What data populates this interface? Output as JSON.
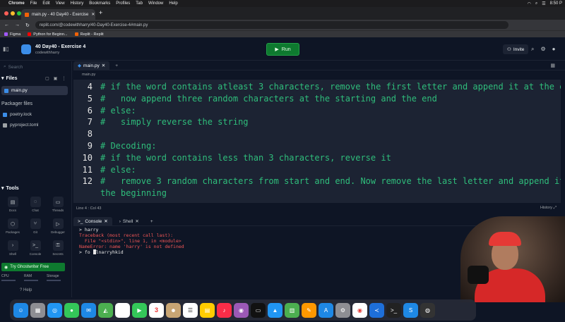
{
  "menubar": {
    "app": "Chrome",
    "items": [
      "File",
      "Edit",
      "View",
      "History",
      "Bookmarks",
      "Profiles",
      "Tab",
      "Window",
      "Help"
    ],
    "clock": "8:50 P"
  },
  "browser": {
    "tab_title": "main.py - 40 Day40 - Exercise",
    "url": "replit.com/@codewithharry/40-Day40-Exercise-4#main.py",
    "bookmarks": [
      "Figma",
      "Python for Beginn...",
      "Replit - Replit"
    ]
  },
  "header": {
    "project_title": "40 Day40 - Exercise 4",
    "owner": "codewithharry",
    "run_label": "Run",
    "invite_label": "Invite"
  },
  "sidebar": {
    "search_placeholder": "Search",
    "files_label": "Files",
    "active_file": "main.py",
    "packager_label": "Packager files",
    "packager_files": [
      "poetry.lock",
      "pyproject.toml"
    ],
    "tools_label": "Tools",
    "tools": [
      "Docs",
      "Chat",
      "Threads",
      "Packages",
      "Git",
      "Debugger",
      "Shell",
      "Console",
      "Secrets"
    ],
    "ghostwriter_label": "Try Ghostwriter Free",
    "usage": [
      "CPU",
      "RAM",
      "Storage"
    ],
    "help_label": "Help"
  },
  "editor": {
    "tab_label": "main.py",
    "breadcrumb": "main.py",
    "lines": [
      {
        "n": "4",
        "t": "# if the word contains atleast 3 characters, remove the first letter and append it at the end"
      },
      {
        "n": "5",
        "t": "#   now append three random characters at the starting and the end"
      },
      {
        "n": "6",
        "t": "# else:"
      },
      {
        "n": "7",
        "t": "#   simply reverse the string"
      },
      {
        "n": "8",
        "t": ""
      },
      {
        "n": "9",
        "t": "# Decoding:"
      },
      {
        "n": "10",
        "t": "# if the word contains less than 3 characters, reverse it"
      },
      {
        "n": "11",
        "t": "# else:"
      },
      {
        "n": "12",
        "t": "#   remove 3 random characters from start and end. Now remove the last letter and append it to"
      },
      {
        "n": "",
        "t": "the beginning"
      }
    ],
    "status": "Line 4 : Col 43",
    "history_label": "History"
  },
  "console": {
    "tabs": [
      "Console",
      "Shell"
    ],
    "lines": [
      {
        "kind": "prompt",
        "text": "> harry"
      },
      {
        "kind": "err",
        "text": "Traceback (most recent call last):"
      },
      {
        "kind": "err",
        "text": "  File \"<stdin>\", line 1, in <module>"
      },
      {
        "kind": "err",
        "text": "NameError: name 'harry' is not defined"
      }
    ],
    "input_before": "> fo ",
    "input_after": "lnarryhkid"
  },
  "dock": {
    "calendar_day": "3"
  }
}
